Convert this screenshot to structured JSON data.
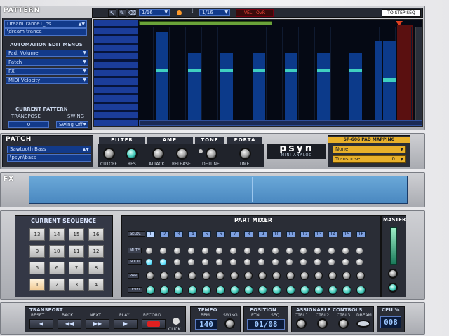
{
  "pattern": {
    "rack_label": "PATTERN",
    "pattern_name": "DreamTrance1_bs",
    "pattern_bank": "\\dream trance",
    "automation_title": "AUTOMATION EDIT MENUS",
    "automation_items": [
      "Fad. Volume",
      "Patch",
      "FX",
      "MIDI Velocity"
    ],
    "current_pattern_title": "CURRENT PATTERN",
    "transpose_label": "TRANSPOSE",
    "swing_label": "SWING",
    "transpose_value": "0",
    "swing_value": "Swing Off",
    "toolbar": {
      "step1": "1/16",
      "step2": "1/16",
      "vel_label": "VEL - OVR",
      "to_step_seq": "TO STEP SEQ"
    }
  },
  "patch": {
    "rack_label": "PATCH",
    "patch_name": "Sawtooth Bass",
    "patch_bank": "\\psyn\\bass",
    "filter_title": "FILTER",
    "amp_title": "AMP",
    "tone_title": "TONE",
    "porta_title": "PORTA",
    "cutoff": "CUTOFF",
    "res": "RES",
    "attack": "ATTACK",
    "release": "RELEASE",
    "detune": "DETUNE",
    "time": "TIME",
    "logo": "psyn",
    "logo_sub": "MINI ANALOG",
    "sp_title": "SP-606 PAD MAPPING",
    "sp_value1": "None",
    "sp_value2": "Transpose",
    "sp_value2_num": "0"
  },
  "fx": {
    "rack_label": "FX"
  },
  "sequence": {
    "title": "CURRENT SEQUENCE",
    "pads": [
      "13",
      "14",
      "15",
      "16",
      "9",
      "10",
      "11",
      "12",
      "5",
      "6",
      "7",
      "8",
      "1",
      "2",
      "3",
      "4"
    ],
    "active_pad": "1"
  },
  "mixer": {
    "title": "PART MIXER",
    "master": "MASTER",
    "row_labels": [
      "SELECT",
      "MUTE",
      "SOLO",
      "PAN",
      "LEVEL"
    ],
    "channels": [
      "1",
      "2",
      "3",
      "4",
      "5",
      "6",
      "7",
      "8",
      "9",
      "10",
      "11",
      "12",
      "13",
      "14",
      "15",
      "16"
    ]
  },
  "transport": {
    "title": "TRANSPORT",
    "reset": "RESET",
    "back": "BACK",
    "next": "NEXT",
    "play": "PLAY",
    "record": "RECORD",
    "click": "CLICK",
    "tempo_title": "TEMPO",
    "bpm_label": "BPM",
    "swing_label": "SWING",
    "bpm": "140",
    "position_title": "POSITION",
    "ptn_label": "PTN",
    "seq_label": "SEQ",
    "position": "01/08",
    "assign_title": "ASSIGNABLE CONTROLS",
    "ctrl1": "CTRL1",
    "ctrl2": "CTRL2",
    "ctrl3": "CTRL3",
    "dbeam": "DBEAM",
    "cpu_title": "CPU %",
    "cpu": "008"
  },
  "colors": {
    "accent": "#2a6ad0",
    "note": "#3fd0c0",
    "playhead": "#e04020"
  }
}
